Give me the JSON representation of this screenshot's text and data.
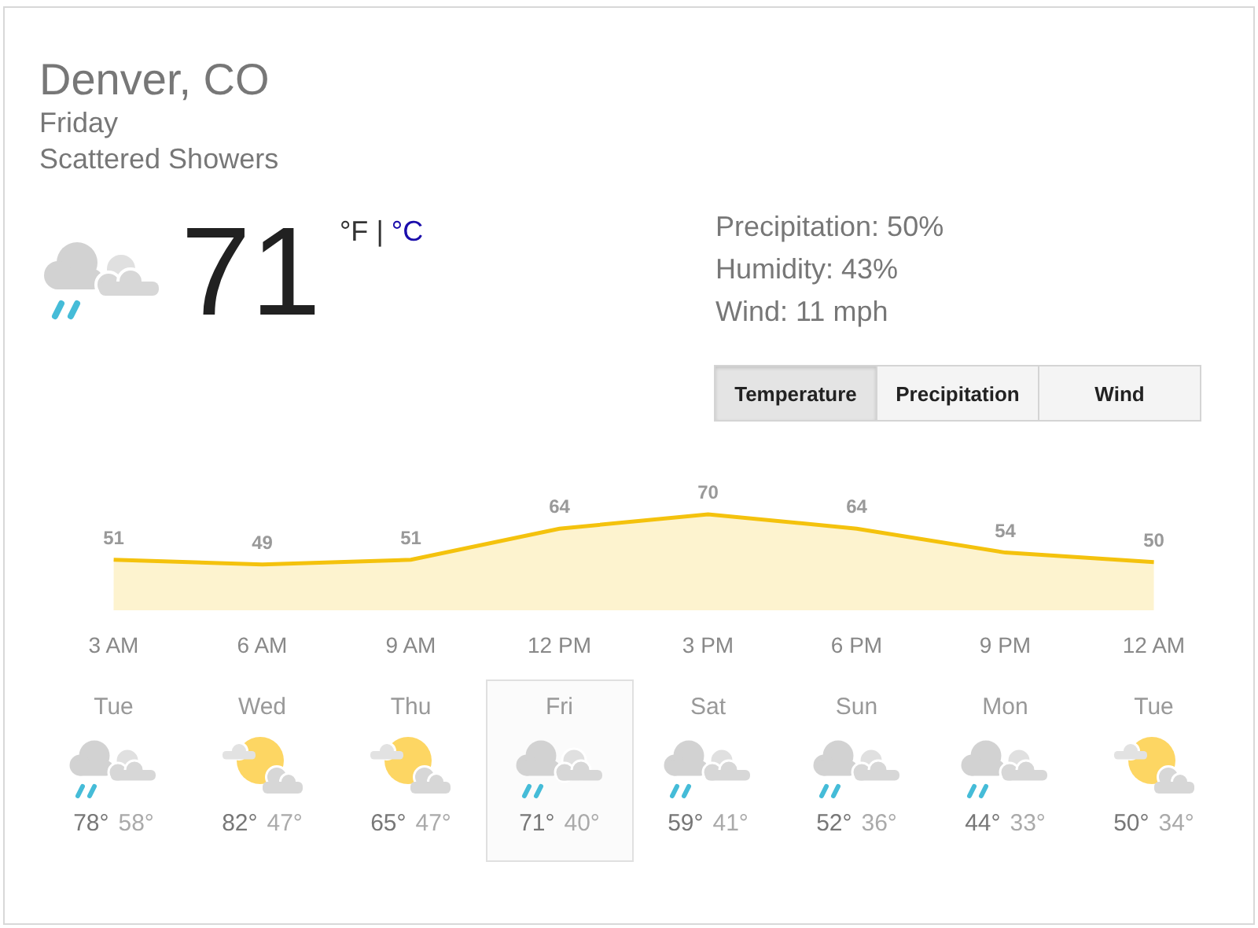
{
  "location": "Denver, CO",
  "day": "Friday",
  "condition": "Scattered Showers",
  "current": {
    "kind": "rain",
    "temperature": "71",
    "separator": "|",
    "units": [
      {
        "label": "°F",
        "selected": true
      },
      {
        "label": "°C",
        "selected": false
      }
    ]
  },
  "details": [
    "Precipitation: 50%",
    "Humidity: 43%",
    "Wind: 11 mph"
  ],
  "tabs": [
    {
      "label": "Temperature",
      "selected": true
    },
    {
      "label": "Precipitation",
      "selected": false
    },
    {
      "label": "Wind",
      "selected": false
    }
  ],
  "chart_data": {
    "type": "area",
    "categories": [
      "3 AM",
      "6 AM",
      "9 AM",
      "12 PM",
      "3 PM",
      "6 PM",
      "9 PM",
      "12 AM"
    ],
    "series": [
      {
        "color": "#f4c20d",
        "values": [
          51,
          49,
          51,
          64,
          70,
          64,
          54,
          50
        ]
      }
    ],
    "data_labels": true
  },
  "forecast": [
    {
      "day": "Tue",
      "kind": "rain",
      "high": "78°",
      "low": "58°",
      "selected": false
    },
    {
      "day": "Wed",
      "kind": "partly_sunny",
      "high": "82°",
      "low": "47°",
      "selected": false
    },
    {
      "day": "Thu",
      "kind": "partly_sunny",
      "high": "65°",
      "low": "47°",
      "selected": false
    },
    {
      "day": "Fri",
      "kind": "rain",
      "high": "71°",
      "low": "40°",
      "selected": true
    },
    {
      "day": "Sat",
      "kind": "rain",
      "high": "59°",
      "low": "41°",
      "selected": false
    },
    {
      "day": "Sun",
      "kind": "rain",
      "high": "52°",
      "low": "36°",
      "selected": false
    },
    {
      "day": "Mon",
      "kind": "rain",
      "high": "44°",
      "low": "33°",
      "selected": false
    },
    {
      "day": "Tue",
      "kind": "partly_sunny",
      "high": "50°",
      "low": "34°",
      "selected": false
    }
  ]
}
